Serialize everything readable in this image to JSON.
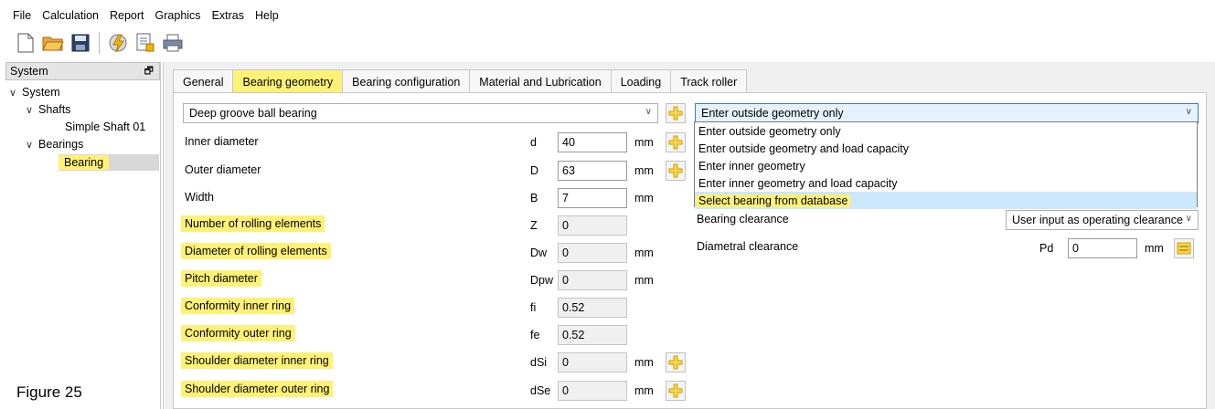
{
  "menu": [
    "File",
    "Calculation",
    "Report",
    "Graphics",
    "Extras",
    "Help"
  ],
  "toolbar": {
    "icons": [
      "new-document-icon",
      "open-folder-icon",
      "save-icon",
      "calculate-icon",
      "report-icon",
      "print-icon"
    ]
  },
  "system_panel": {
    "title": "System",
    "tree": {
      "root": "System",
      "shafts_label": "Shafts",
      "shaft_item": "Simple Shaft 01",
      "bearings_label": "Bearings",
      "bearing_item": "Bearing"
    }
  },
  "tabs": [
    {
      "label": "General"
    },
    {
      "label": "Bearing geometry",
      "active": true
    },
    {
      "label": "Bearing configuration"
    },
    {
      "label": "Material and Lubrication"
    },
    {
      "label": "Loading"
    },
    {
      "label": "Track roller"
    }
  ],
  "bearing_type": "Deep groove ball bearing",
  "geometry_mode": {
    "selected": "Enter outside geometry only",
    "options": [
      "Enter outside geometry only",
      "Enter outside geometry and load capacity",
      "Enter inner geometry",
      "Enter inner geometry and load capacity",
      "Select bearing from database"
    ],
    "highlighted": "Select bearing from database"
  },
  "rows": [
    {
      "label": "Inner diameter",
      "symbol": "d",
      "value": "40",
      "unit": "mm"
    },
    {
      "label": "Outer diameter",
      "symbol": "D",
      "value": "63",
      "unit": "mm"
    },
    {
      "label": "Width",
      "symbol": "B",
      "value": "7",
      "unit": "mm"
    },
    {
      "label": "Number of rolling elements",
      "symbol": "Z",
      "value": "0",
      "unit": ""
    },
    {
      "label": "Diameter of rolling elements",
      "symbol": "Dw",
      "value": "0",
      "unit": "mm"
    },
    {
      "label": "Pitch diameter",
      "symbol": "Dpw",
      "value": "0",
      "unit": "mm"
    },
    {
      "label": "Conformity inner ring",
      "symbol": "fi",
      "value": "0.52",
      "unit": ""
    },
    {
      "label": "Conformity outer ring",
      "symbol": "fe",
      "value": "0.52",
      "unit": ""
    },
    {
      "label": "Shoulder diameter inner ring",
      "symbol": "dSi",
      "value": "0",
      "unit": "mm"
    },
    {
      "label": "Shoulder diameter outer ring",
      "symbol": "dSe",
      "value": "0",
      "unit": "mm"
    }
  ],
  "clearance": {
    "label": "Bearing clearance",
    "mode": "User input as operating clearance",
    "diametral_label": "Diametral clearance",
    "diametral_symbol": "Pd",
    "diametral_value": "0",
    "diametral_unit": "mm"
  },
  "figure_label": "Figure 25",
  "colors": {
    "highlight": "#fff176",
    "selection": "#cce8ff",
    "tab_bg": "#f0f0f0"
  }
}
